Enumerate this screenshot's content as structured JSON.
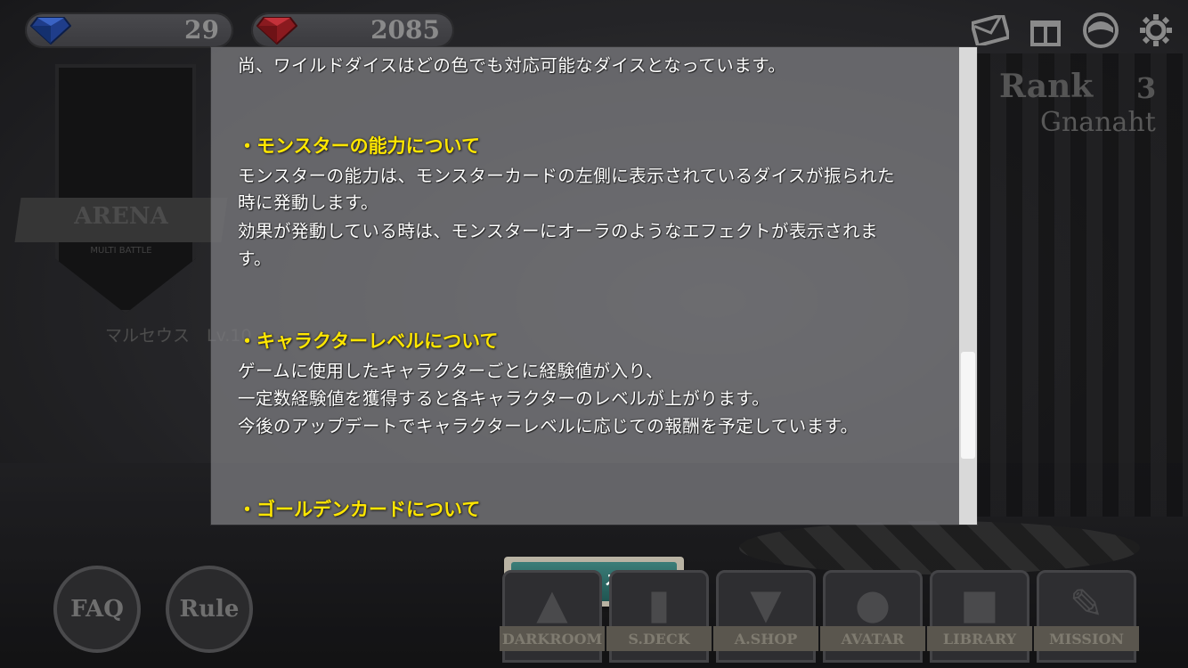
{
  "currency": {
    "blue_gems": "29",
    "red_gems": "2085"
  },
  "top_icons": [
    "mail-icon",
    "gift-icon",
    "avatar-icon",
    "settings-gear-icon"
  ],
  "background": {
    "arena_title": "ARENA",
    "arena_subtitle": "MULTI BATTLE",
    "character_label": "マルセウス　Lv.10",
    "rank_label": "Rank",
    "rank_value": "3",
    "player_name": "Gnanaht"
  },
  "modal": {
    "lines": [
      {
        "kind": "text",
        "text": "尚、ワイルドダイスはどの色でも対応可能なダイスとなっています。"
      },
      {
        "kind": "heading",
        "text": "・モンスターの能力について"
      },
      {
        "kind": "text",
        "text": "モンスターの能力は、モンスターカードの左側に表示されているダイスが振られた"
      },
      {
        "kind": "text",
        "text": "時に発動します。"
      },
      {
        "kind": "text",
        "text": "効果が発動している時は、モンスターにオーラのようなエフェクトが表示されま"
      },
      {
        "kind": "text",
        "text": "す。"
      },
      {
        "kind": "heading",
        "text": "・キャラクターレベルについて"
      },
      {
        "kind": "text",
        "text": "ゲームに使用したキャラクターごとに経験値が入り、"
      },
      {
        "kind": "text",
        "text": "一定数経験値を獲得すると各キャラクターのレベルが上がります。"
      },
      {
        "kind": "text",
        "text": "今後のアップデートでキャラクターレベルに応じての報酬を予定しています。"
      },
      {
        "kind": "heading",
        "text": "・ゴールデンカードについて"
      }
    ],
    "close_label": "閉じる"
  },
  "side_buttons": {
    "faq": "FAQ",
    "rule": "Rule"
  },
  "nav": [
    {
      "label": "DARKROOM"
    },
    {
      "label": "S.DECK"
    },
    {
      "label": "A.SHOP"
    },
    {
      "label": "AVATAR"
    },
    {
      "label": "LIBRARY"
    },
    {
      "label": "MISSION"
    }
  ]
}
